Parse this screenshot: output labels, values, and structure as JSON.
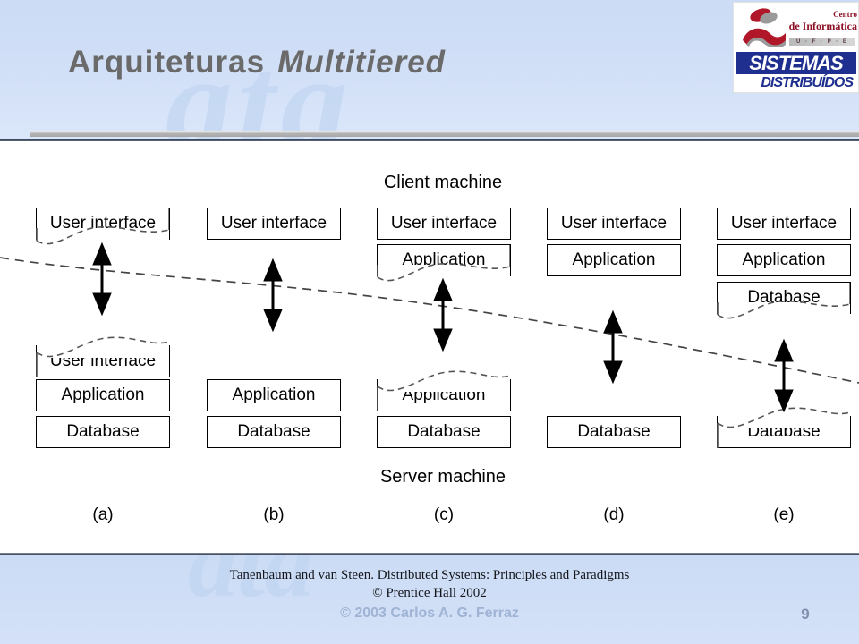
{
  "header": {
    "title_main": "Arquiteturas",
    "title_italic": "Multitiered",
    "logo": {
      "centro": "Centro",
      "de_informatica": "de Informática",
      "university": "U · F · P · E",
      "sistemas": "SISTEMAS",
      "distribuidos": "DISTRIBUÍDOS"
    }
  },
  "diagram": {
    "client_label": "Client machine",
    "server_label": "Server machine",
    "labels": {
      "ui": "User interface",
      "app": "Application",
      "db": "Database"
    },
    "columns": [
      {
        "id": "a",
        "caption": "(a)",
        "client": [
          "User interface"
        ],
        "server": [
          "User interface",
          "Application",
          "Database"
        ],
        "split": "ui"
      },
      {
        "id": "b",
        "caption": "(b)",
        "client": [
          "User interface"
        ],
        "server": [
          "Application",
          "Database"
        ],
        "split": "none"
      },
      {
        "id": "c",
        "caption": "(c)",
        "client": [
          "User interface",
          "Application"
        ],
        "server": [
          "Application",
          "Database"
        ],
        "split": "app"
      },
      {
        "id": "d",
        "caption": "(d)",
        "client": [
          "User interface",
          "Application"
        ],
        "server": [
          "Database"
        ],
        "split": "none"
      },
      {
        "id": "e",
        "caption": "(e)",
        "client": [
          "User interface",
          "Application",
          "Database"
        ],
        "server": [
          "Database"
        ],
        "split": "db"
      }
    ]
  },
  "footer": {
    "line1": "Tanenbaum and van Steen. Distributed Systems: Principles and Paradigms",
    "line2": "© Prentice Hall  2002",
    "line3": "© 2003 Carlos A. G. Ferraz",
    "page_number": "9"
  },
  "colors": {
    "header_bg": "#ccdcf5",
    "title_text": "#6a6a6a",
    "rule": "#1d2433",
    "footer_accent": "#9fb3d4",
    "logo_red": "#8d1125",
    "logo_blue": "#1f2f8f"
  }
}
